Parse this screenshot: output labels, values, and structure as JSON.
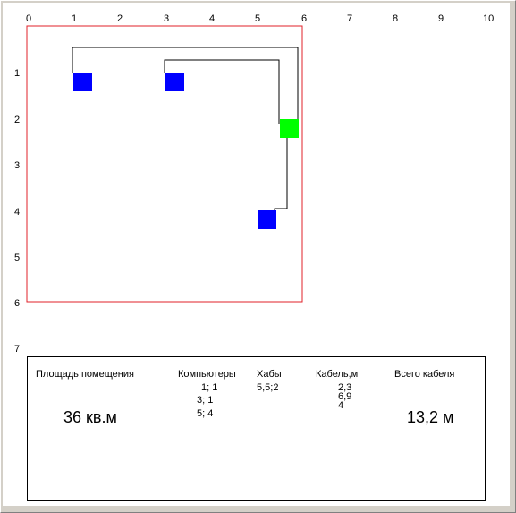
{
  "axis": {
    "x_ticks": [
      "0",
      "1",
      "2",
      "3",
      "4",
      "5",
      "6",
      "7",
      "8",
      "9",
      "10"
    ],
    "y_ticks": [
      "1",
      "2",
      "3",
      "4",
      "5",
      "6",
      "7"
    ]
  },
  "room": {
    "border_color": "#e0202a"
  },
  "computers": [
    {
      "x": 1,
      "y": 1,
      "color": "#0000ff"
    },
    {
      "x": 3,
      "y": 1,
      "color": "#0000ff"
    },
    {
      "x": 5,
      "y": 4,
      "color": "#0000ff"
    }
  ],
  "hubs": [
    {
      "x": 5.5,
      "y": 2,
      "color": "#00ff00"
    }
  ],
  "info": {
    "area_label": "Площадь помещения",
    "area_value": "36 кв.м",
    "computers_label": "Компьютеры",
    "computers_values": [
      "1; 1",
      "3; 1",
      "5; 4"
    ],
    "hubs_label": "Хабы",
    "hubs_values": [
      "5,5;2"
    ],
    "cable_label": "Кабель,м",
    "cable_values": [
      "2,3",
      "6,9",
      "4"
    ],
    "total_label": "Всего кабеля",
    "total_value": "13,2 м"
  }
}
